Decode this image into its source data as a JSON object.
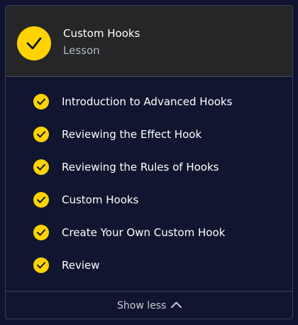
{
  "header": {
    "title": "Custom Hooks",
    "subtitle": "Lesson",
    "icon": "check-circle-icon"
  },
  "lessons": [
    {
      "label": "Introduction to Advanced Hooks",
      "completed": true
    },
    {
      "label": "Reviewing the Effect Hook",
      "completed": true
    },
    {
      "label": "Reviewing the Rules of Hooks",
      "completed": true
    },
    {
      "label": "Custom Hooks",
      "completed": true
    },
    {
      "label": "Create Your Own Custom Hook",
      "completed": true
    },
    {
      "label": "Review",
      "completed": true
    }
  ],
  "footer": {
    "toggle_label": "Show less",
    "toggle_icon": "chevron-up-icon"
  },
  "colors": {
    "accent": "#ffd300",
    "background": "#10162f",
    "header_background": "#242628",
    "text": "#ffffff",
    "muted_text": "#b3b6bf"
  }
}
